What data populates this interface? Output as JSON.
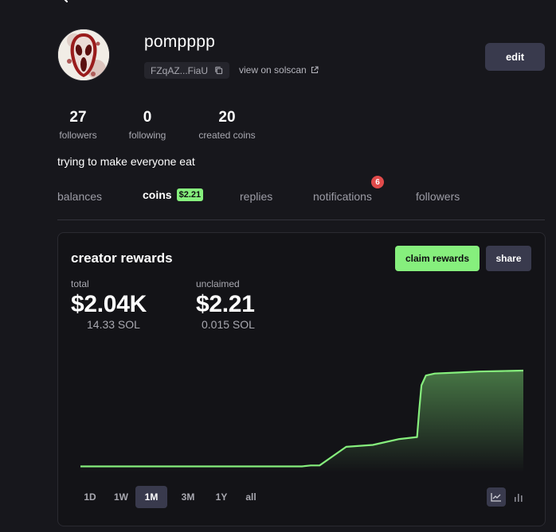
{
  "profile": {
    "username": "pompppp",
    "address_short": "FZqAZ...FiaU",
    "view_on_solscan": "view on solscan",
    "edit_label": "edit",
    "bio": "trying to make everyone eat"
  },
  "stats": [
    {
      "value": "27",
      "label": "followers"
    },
    {
      "value": "0",
      "label": "following"
    },
    {
      "value": "20",
      "label": "created coins"
    }
  ],
  "tabs": [
    {
      "label": "balances"
    },
    {
      "label": "coins",
      "badge": "$2.21",
      "active": true
    },
    {
      "label": "replies"
    },
    {
      "label": "notifications",
      "badge": "6"
    },
    {
      "label": "followers"
    }
  ],
  "rewards": {
    "title": "creator rewards",
    "claim_label": "claim rewards",
    "share_label": "share",
    "total_label": "total",
    "total_value": "$2.04K",
    "total_sol": "14.33 SOL",
    "unclaimed_label": "unclaimed",
    "unclaimed_value": "$2.21",
    "unclaimed_sol": "0.015 SOL",
    "ranges": [
      "1D",
      "1W",
      "1M",
      "3M",
      "1Y",
      "all"
    ],
    "active_range": "1M",
    "view_icons": [
      "line-chart-icon",
      "bar-chart-icon"
    ]
  },
  "colors": {
    "accent_green": "#86ef7d",
    "button_gray": "#393a4d",
    "badge_red": "#e14b4b",
    "background": "#17171c"
  },
  "chart_data": {
    "type": "area",
    "title": "",
    "xlabel": "",
    "ylabel": "",
    "x": [
      0,
      0.5,
      0.52,
      0.54,
      0.6,
      0.66,
      0.68,
      0.72,
      0.76,
      0.765,
      0.77,
      0.78,
      0.8,
      0.85,
      0.9,
      0.95,
      1.0
    ],
    "series": [
      {
        "values": [
          2,
          2,
          3,
          3,
          22,
          24,
          26,
          30,
          32,
          60,
          85,
          95,
          97,
          98,
          99,
          99.5,
          100
        ]
      }
    ],
    "ylim": [
      0,
      100
    ],
    "grid": false
  }
}
